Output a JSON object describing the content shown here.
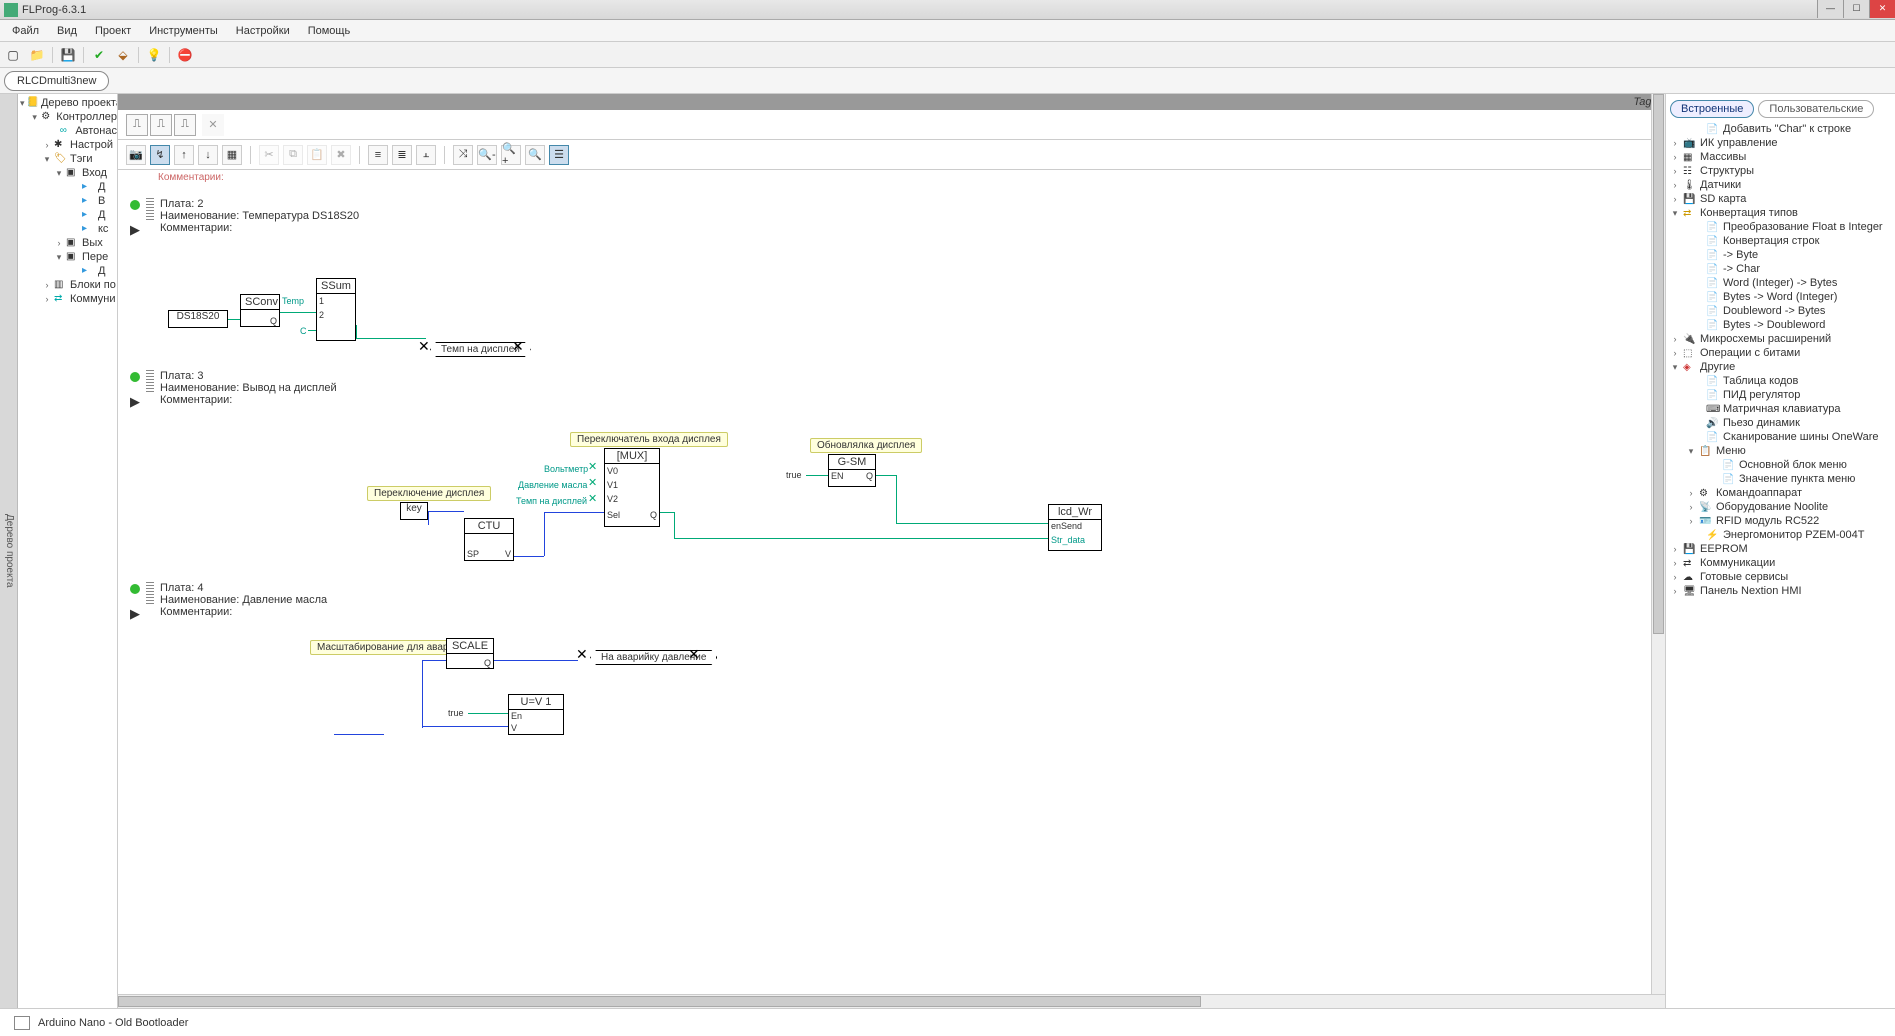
{
  "window": {
    "title": "FLProg-6.3.1"
  },
  "menu": [
    "Файл",
    "Вид",
    "Проект",
    "Инструменты",
    "Настройки",
    "Помощь"
  ],
  "tab": "RLCDmulti3new",
  "sidelabel": "Дерево проекта",
  "tree": {
    "root": "Дерево проекта",
    "controller": "Контроллер",
    "auto": "Автонас",
    "settings": "Настрой",
    "tags": "Тэги",
    "in": "Вход",
    "d1": "Д",
    "b": "В",
    "d2": "Д",
    "kc": "кс",
    "out": "Вых",
    "pere": "Пере",
    "d3": "Д",
    "blocks": "Блоки по",
    "comm": "Коммуни"
  },
  "tagsbar": "Tags",
  "boards": {
    "b2": {
      "num": "Плата: 2",
      "name": "Наименование: Температура DS18S20",
      "cmt": "Комментарии:"
    },
    "b3": {
      "num": "Плата: 3",
      "name": "Наименование: Вывод на дисплей",
      "cmt": "Комментарии:"
    },
    "b4": {
      "num": "Плата: 4",
      "name": "Наименование: Давление масла",
      "cmt": "Комментарии:"
    }
  },
  "blocks": {
    "ds18": "DS18S20",
    "sconv": "SConv",
    "ssum": "SSum",
    "temp": "Темп на дисплей",
    "key": "key",
    "ctu": "CTU",
    "mux": "[MUX]",
    "gsm": "G-SM",
    "lcdwr": "lcd_Wr",
    "scale": "SCALE",
    "uv1": "U=V 1",
    "c_peredisp": "Переключение дисплея",
    "c_peremux": "Переключатель входа дисплея",
    "c_obn": "Обновлялка дисплея",
    "c_scale": "Масштабирование для аварийки",
    "volt": "Вольтметр",
    "davl": "Давление масла",
    "temp2": "Темп на дисплей",
    "naavar": "На аварийку давление",
    "temp_lbl": "Temp",
    "c_lbl": "C",
    "q_lbl": "Q",
    "sp": "SP",
    "v": "V",
    "sel": "Sel",
    "v0": "V0",
    "v1": "V1",
    "v2": "V2",
    "en": "EN",
    "true": "true",
    "ensend": "enSend",
    "strdata": "Str_data",
    "en2": "En"
  },
  "rtabs": {
    "a": "Встроенные",
    "b": "Пользовательские"
  },
  "rtree": {
    "addchar": "Добавить \"Char\" к строке",
    "ik": "ИК управление",
    "arr": "Массивы",
    "struct": "Структуры",
    "sens": "Датчики",
    "sd": "SD карта",
    "conv": "Конвертация типов",
    "fi": "Преобразование Float в Integer",
    "cs": "Конвертация строк",
    "tb": "-> Byte",
    "tc": "-> Char",
    "wib": "Word (Integer) -> Bytes",
    "bwi": "Bytes -> Word (Integer)",
    "dwb": "Doubleword -> Bytes",
    "bdw": "Bytes -> Doubleword",
    "chips": "Микросхемы расширений",
    "bits": "Операции с битами",
    "other": "Другие",
    "tcodes": "Таблица кодов",
    "pid": "ПИД регулятор",
    "mk": "Матричная клавиатура",
    "piezo": "Пьезо динамик",
    "ow": "Сканирование шины OneWare",
    "menu": "Меню",
    "mblock": "Основной блок меню",
    "mval": "Значение пункта меню",
    "cmd": "Командоаппарат",
    "noo": "Оборудование Noolite",
    "rfid": "RFID модуль RC522",
    "pzem": "Энергомонитор PZEM-004T",
    "eeprom": "EEPROM",
    "comm": "Коммуникации",
    "srv": "Готовые сервисы",
    "nex": "Панель Nextion HMI"
  },
  "status": "Arduino Nano - Old Bootloader",
  "top_cmt": "Комментарии:"
}
